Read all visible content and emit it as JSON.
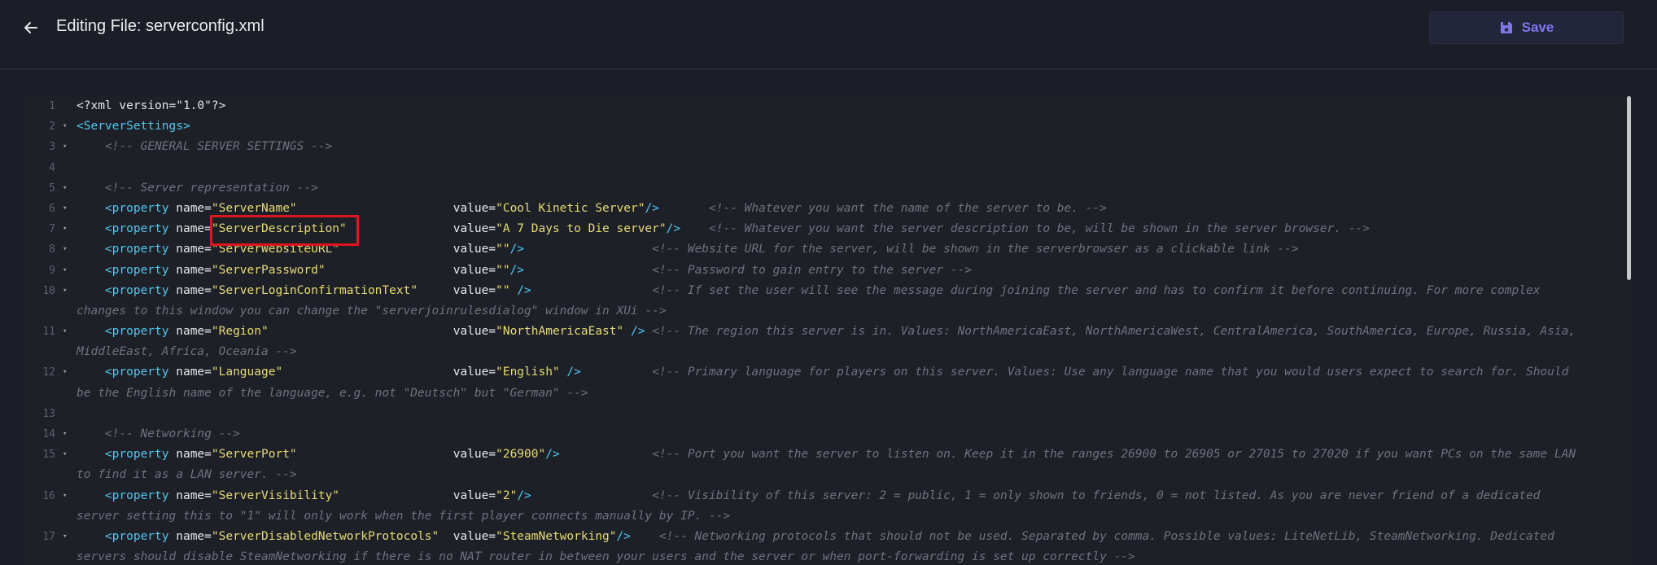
{
  "header": {
    "title": "Editing File: serverconfig.xml",
    "save_label": "Save",
    "back_icon": "arrow-left-icon",
    "save_icon": "floppy-disk-icon",
    "accent": "#7f76ea"
  },
  "editor": {
    "lines": [
      {
        "n": "1",
        "fold": "",
        "parts": [
          {
            "t": "plain",
            "v": "<?xml version=\"1.0\"?>"
          }
        ]
      },
      {
        "n": "2",
        "fold": "▾",
        "parts": [
          {
            "t": "tag",
            "v": "<ServerSettings>"
          }
        ]
      },
      {
        "n": "3",
        "fold": "▾",
        "parts": [
          {
            "t": "plain",
            "v": "    "
          },
          {
            "t": "cmt",
            "v": "<!-- GENERAL SERVER SETTINGS -->"
          }
        ]
      },
      {
        "n": "4",
        "fold": "",
        "parts": [
          {
            "t": "plain",
            "v": " "
          }
        ]
      },
      {
        "n": "5",
        "fold": "▾",
        "parts": [
          {
            "t": "plain",
            "v": "    "
          },
          {
            "t": "cmt",
            "v": "<!-- Server representation -->"
          }
        ]
      },
      {
        "n": "6",
        "fold": "▾",
        "parts": [
          {
            "t": "plain",
            "v": "    "
          },
          {
            "t": "tag",
            "v": "<property"
          },
          {
            "t": "attr",
            "v": " name="
          },
          {
            "t": "str",
            "v": "\"ServerName\""
          },
          {
            "t": "plain",
            "v": "                      "
          },
          {
            "t": "attr",
            "v": "value="
          },
          {
            "t": "str",
            "v": "\"Cool Kinetic Server\""
          },
          {
            "t": "tag",
            "v": "/>"
          },
          {
            "t": "plain",
            "v": "       "
          },
          {
            "t": "cmt",
            "v": "<!-- Whatever you want the name of the server to be. -->"
          }
        ]
      },
      {
        "n": "7",
        "fold": "▾",
        "parts": [
          {
            "t": "plain",
            "v": "    "
          },
          {
            "t": "tag",
            "v": "<property"
          },
          {
            "t": "attr",
            "v": " name="
          },
          {
            "t": "str",
            "v": "\"ServerDescription\""
          },
          {
            "t": "plain",
            "v": "               "
          },
          {
            "t": "attr",
            "v": "value="
          },
          {
            "t": "str",
            "v": "\"A 7 Days to Die server\""
          },
          {
            "t": "tag",
            "v": "/>"
          },
          {
            "t": "plain",
            "v": "    "
          },
          {
            "t": "cmt",
            "v": "<!-- Whatever you want the server description to be, will be shown in the server browser. -->"
          }
        ]
      },
      {
        "n": "8",
        "fold": "▾",
        "parts": [
          {
            "t": "plain",
            "v": "    "
          },
          {
            "t": "tag",
            "v": "<property"
          },
          {
            "t": "attr",
            "v": " name="
          },
          {
            "t": "str",
            "v": "\"ServerWebsiteURL\""
          },
          {
            "t": "plain",
            "v": "                "
          },
          {
            "t": "attr",
            "v": "value="
          },
          {
            "t": "str",
            "v": "\"\""
          },
          {
            "t": "tag",
            "v": "/>"
          },
          {
            "t": "plain",
            "v": "                  "
          },
          {
            "t": "cmt",
            "v": "<!-- Website URL for the server, will be shown in the serverbrowser as a clickable link -->"
          }
        ]
      },
      {
        "n": "9",
        "fold": "▾",
        "parts": [
          {
            "t": "plain",
            "v": "    "
          },
          {
            "t": "tag",
            "v": "<property"
          },
          {
            "t": "attr",
            "v": " name="
          },
          {
            "t": "str",
            "v": "\"ServerPassword\""
          },
          {
            "t": "plain",
            "v": "                  "
          },
          {
            "t": "attr",
            "v": "value="
          },
          {
            "t": "str",
            "v": "\"\""
          },
          {
            "t": "tag",
            "v": "/>"
          },
          {
            "t": "plain",
            "v": "                  "
          },
          {
            "t": "cmt",
            "v": "<!-- Password to gain entry to the server -->"
          }
        ]
      },
      {
        "n": "10",
        "fold": "▾",
        "parts": [
          {
            "t": "plain",
            "v": "    "
          },
          {
            "t": "tag",
            "v": "<property"
          },
          {
            "t": "attr",
            "v": " name="
          },
          {
            "t": "str",
            "v": "\"ServerLoginConfirmationText\""
          },
          {
            "t": "plain",
            "v": "     "
          },
          {
            "t": "attr",
            "v": "value="
          },
          {
            "t": "str",
            "v": "\"\""
          },
          {
            "t": "tag",
            "v": " />"
          },
          {
            "t": "plain",
            "v": "                 "
          },
          {
            "t": "cmt",
            "v": "<!-- If set the user will see the message during joining the server and has to confirm it before continuing. For more complex"
          }
        ],
        "wrap": "changes to this window you can change the \"serverjoinrulesdialog\" window in XUi -->"
      },
      {
        "n": "11",
        "fold": "▾",
        "parts": [
          {
            "t": "plain",
            "v": "    "
          },
          {
            "t": "tag",
            "v": "<property"
          },
          {
            "t": "attr",
            "v": " name="
          },
          {
            "t": "str",
            "v": "\"Region\""
          },
          {
            "t": "plain",
            "v": "                          "
          },
          {
            "t": "attr",
            "v": "value="
          },
          {
            "t": "str",
            "v": "\"NorthAmericaEast\""
          },
          {
            "t": "tag",
            "v": " />"
          },
          {
            "t": "plain",
            "v": " "
          },
          {
            "t": "cmt",
            "v": "<!-- The region this server is in. Values: NorthAmericaEast, NorthAmericaWest, CentralAmerica, SouthAmerica, Europe, Russia, Asia,"
          }
        ],
        "wrap": "MiddleEast, Africa, Oceania -->"
      },
      {
        "n": "12",
        "fold": "▾",
        "parts": [
          {
            "t": "plain",
            "v": "    "
          },
          {
            "t": "tag",
            "v": "<property"
          },
          {
            "t": "attr",
            "v": " name="
          },
          {
            "t": "str",
            "v": "\"Language\""
          },
          {
            "t": "plain",
            "v": "                        "
          },
          {
            "t": "attr",
            "v": "value="
          },
          {
            "t": "str",
            "v": "\"English\""
          },
          {
            "t": "tag",
            "v": " />"
          },
          {
            "t": "plain",
            "v": "          "
          },
          {
            "t": "cmt",
            "v": "<!-- Primary language for players on this server. Values: Use any language name that you would users expect to search for. Should"
          }
        ],
        "wrap": "be the English name of the language, e.g. not \"Deutsch\" but \"German\" -->"
      },
      {
        "n": "13",
        "fold": "",
        "parts": [
          {
            "t": "plain",
            "v": " "
          }
        ]
      },
      {
        "n": "14",
        "fold": "▾",
        "parts": [
          {
            "t": "plain",
            "v": "    "
          },
          {
            "t": "cmt",
            "v": "<!-- Networking -->"
          }
        ]
      },
      {
        "n": "15",
        "fold": "▾",
        "parts": [
          {
            "t": "plain",
            "v": "    "
          },
          {
            "t": "tag",
            "v": "<property"
          },
          {
            "t": "attr",
            "v": " name="
          },
          {
            "t": "str",
            "v": "\"ServerPort\""
          },
          {
            "t": "plain",
            "v": "                      "
          },
          {
            "t": "attr",
            "v": "value="
          },
          {
            "t": "str",
            "v": "\"26900\""
          },
          {
            "t": "tag",
            "v": "/>"
          },
          {
            "t": "plain",
            "v": "             "
          },
          {
            "t": "cmt",
            "v": "<!-- Port you want the server to listen on. Keep it in the ranges 26900 to 26905 or 27015 to 27020 if you want PCs on the same LAN"
          }
        ],
        "wrap": "to find it as a LAN server. -->"
      },
      {
        "n": "16",
        "fold": "▾",
        "parts": [
          {
            "t": "plain",
            "v": "    "
          },
          {
            "t": "tag",
            "v": "<property"
          },
          {
            "t": "attr",
            "v": " name="
          },
          {
            "t": "str",
            "v": "\"ServerVisibility\""
          },
          {
            "t": "plain",
            "v": "                "
          },
          {
            "t": "attr",
            "v": "value="
          },
          {
            "t": "str",
            "v": "\"2\""
          },
          {
            "t": "tag",
            "v": "/>"
          },
          {
            "t": "plain",
            "v": "                 "
          },
          {
            "t": "cmt",
            "v": "<!-- Visibility of this server: 2 = public, 1 = only shown to friends, 0 = not listed. As you are never friend of a dedicated"
          }
        ],
        "wrap": "server setting this to \"1\" will only work when the first player connects manually by IP. -->"
      },
      {
        "n": "17",
        "fold": "▾",
        "parts": [
          {
            "t": "plain",
            "v": "    "
          },
          {
            "t": "tag",
            "v": "<property"
          },
          {
            "t": "attr",
            "v": " name="
          },
          {
            "t": "str",
            "v": "\"ServerDisabledNetworkProtocols\""
          },
          {
            "t": "plain",
            "v": "  "
          },
          {
            "t": "attr",
            "v": "value="
          },
          {
            "t": "str",
            "v": "\"SteamNetworking\""
          },
          {
            "t": "tag",
            "v": "/>"
          },
          {
            "t": "plain",
            "v": "    "
          },
          {
            "t": "cmt",
            "v": "<!-- Networking protocols that should not be used. Separated by comma. Possible values: LiteNetLib, SteamNetworking. Dedicated"
          }
        ],
        "wrap": "servers should disable SteamNetworking if there is no NAT router in between your users and the server or when port-forwarding is set up correctly -->"
      }
    ]
  }
}
